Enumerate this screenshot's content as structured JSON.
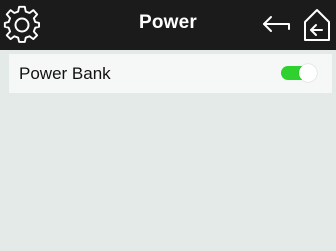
{
  "header": {
    "title": "Power",
    "left_icon": "gear-icon",
    "right_icons": [
      "back-arrow-icon",
      "home-icon"
    ]
  },
  "settings": [
    {
      "label": "Power Bank",
      "toggle_on": true
    }
  ],
  "colors": {
    "header_bg": "#1b1b1b",
    "content_bg": "#e4eae7",
    "row_bg": "#f6f8f7",
    "toggle_on": "#2ed12e"
  }
}
